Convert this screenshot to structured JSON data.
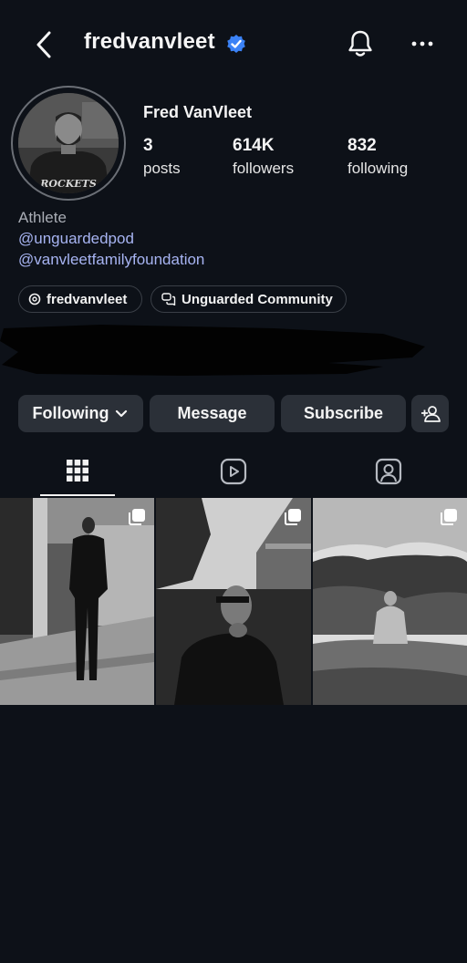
{
  "header": {
    "username": "fredvanvleet"
  },
  "profile": {
    "full_name": "Fred VanVleet",
    "stats": [
      {
        "value": "3",
        "label": "posts"
      },
      {
        "value": "614K",
        "label": "followers"
      },
      {
        "value": "832",
        "label": "following"
      }
    ],
    "category": "Athlete",
    "links": [
      "@unguardedpod",
      "@vanvleetfamilyfoundation"
    ],
    "avatar_shirt_text": "ROCKETS"
  },
  "chips": [
    {
      "icon": "threads-icon",
      "label": "fredvanvleet"
    },
    {
      "icon": "community-chat-icon",
      "label": "Unguarded Community"
    }
  ],
  "actions": {
    "following_label": "Following",
    "message_label": "Message",
    "subscribe_label": "Subscribe"
  },
  "tabs": [
    {
      "icon": "grid-icon",
      "active": true
    },
    {
      "icon": "reels-icon",
      "active": false
    },
    {
      "icon": "tagged-icon",
      "active": false
    }
  ],
  "colors": {
    "background": "#0d1118",
    "button_bg": "#2b3038",
    "link": "#a7b4f2",
    "verified": "#3b82f6"
  }
}
